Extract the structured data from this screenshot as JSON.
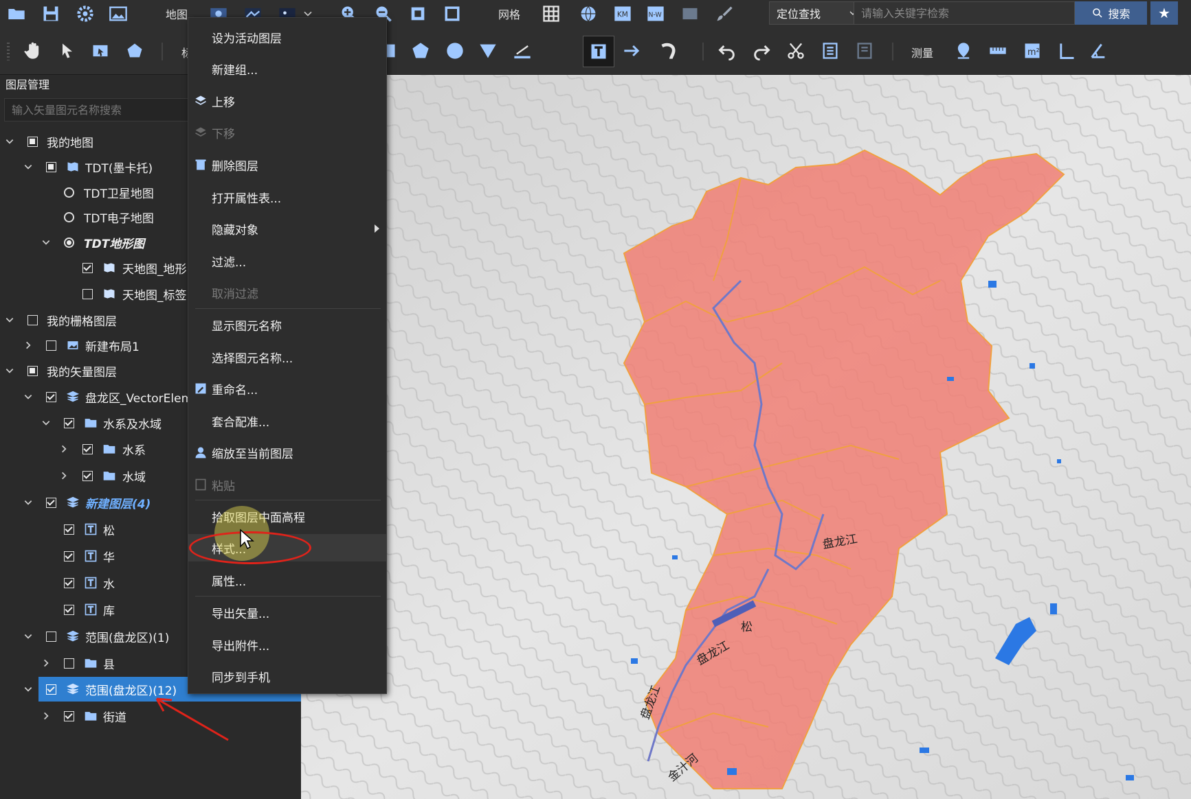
{
  "toolbar": {
    "map_label": "地图",
    "grid_label": "网格",
    "locate_label": "定位查找",
    "search_placeholder": "请输入关键字检索",
    "search_button": "搜索",
    "measure_label": "测量",
    "tool_partial_label": "标"
  },
  "panel": {
    "title": "图层管理",
    "search_placeholder": "输入矢量图元名称搜索",
    "tree": [
      {
        "label": "我的地图"
      },
      {
        "label": "TDT(墨卡托)"
      },
      {
        "label": "TDT卫星地图"
      },
      {
        "label": "TDT电子地图"
      },
      {
        "label": "TDT地形图"
      },
      {
        "label": "天地图_地形"
      },
      {
        "label": "天地图_标签"
      },
      {
        "label": "我的栅格图层"
      },
      {
        "label": "新建布局1"
      },
      {
        "label": "我的矢量图层"
      },
      {
        "label": "盘龙区_VectorElem"
      },
      {
        "label": "水系及水域"
      },
      {
        "label": "水系"
      },
      {
        "label": "水域"
      },
      {
        "label": "新建图层(4)"
      },
      {
        "label": "松"
      },
      {
        "label": "华"
      },
      {
        "label": "水"
      },
      {
        "label": "库"
      },
      {
        "label": "范围(盘龙区)(1)"
      },
      {
        "label": "县"
      },
      {
        "label": "范围(盘龙区)(12)"
      },
      {
        "label": "街道"
      }
    ]
  },
  "context_menu": {
    "items": [
      {
        "label": "设为活动图层"
      },
      {
        "label": "新建组..."
      },
      {
        "label": "上移"
      },
      {
        "label": "下移"
      },
      {
        "label": "删除图层"
      },
      {
        "label": "打开属性表..."
      },
      {
        "label": "隐藏对象"
      },
      {
        "label": "过滤..."
      },
      {
        "label": "取消过滤"
      },
      {
        "label": "显示图元名称"
      },
      {
        "label": "选择图元名称..."
      },
      {
        "label": "重命名..."
      },
      {
        "label": "套合配准..."
      },
      {
        "label": "缩放至当前图层"
      },
      {
        "label": "粘贴"
      },
      {
        "label": "拾取图层中面高程"
      },
      {
        "label": "样式..."
      },
      {
        "label": "属性..."
      },
      {
        "label": "导出矢量..."
      },
      {
        "label": "导出附件..."
      },
      {
        "label": "同步到手机"
      }
    ]
  },
  "map": {
    "labels": [
      "盘龙江",
      "松",
      "盘龙江",
      "盘龙江",
      "金汁河"
    ],
    "colors": {
      "region_fill": "#f07f74",
      "region_border": "#f0a040",
      "river": "#6f78c8",
      "water": "#2b78e4"
    }
  },
  "colors": {
    "selection": "#2f7fd0",
    "annotation": "#e0231a",
    "icon_blue": "#9fc8ff"
  }
}
